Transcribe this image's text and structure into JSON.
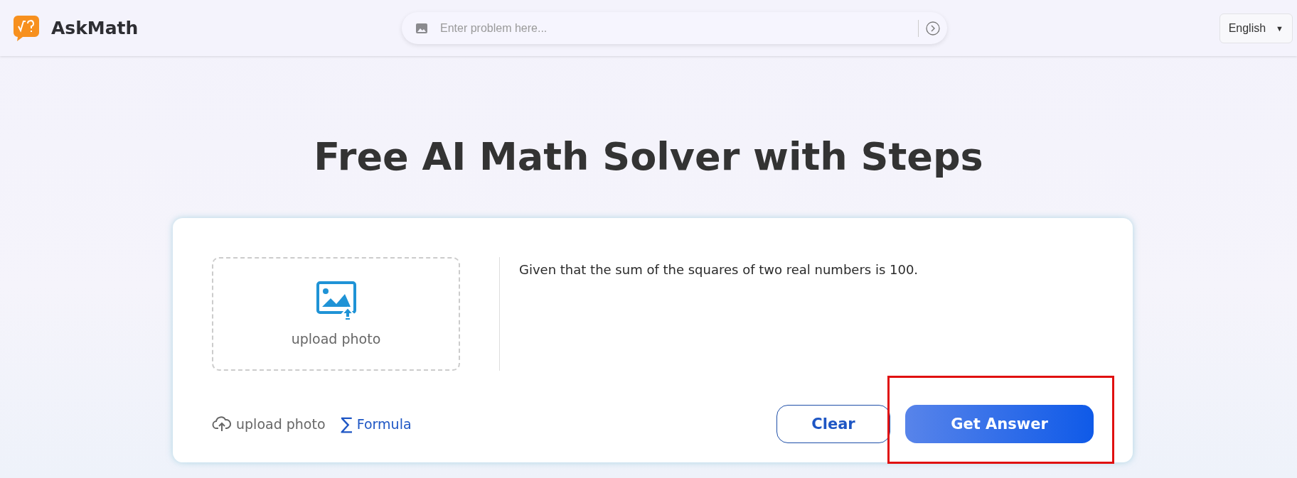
{
  "header": {
    "brand": "AskMath",
    "search": {
      "placeholder": "Enter problem here..."
    },
    "language": {
      "label": "English",
      "caret": "▼"
    }
  },
  "title": "Free AI Math Solver with Steps",
  "solver": {
    "upload_area": {
      "label": "upload photo"
    },
    "problem": {
      "value": "Given that the sum of the squares of two real numbers is 100."
    },
    "tools": [
      {
        "kind": "upload",
        "label": "upload photo"
      },
      {
        "kind": "formula",
        "label": "Formula",
        "symbol": "∑"
      }
    ],
    "buttons": [
      {
        "kind": "outline",
        "label": "Clear",
        "highlighted": false
      },
      {
        "kind": "primary",
        "label": "Get Answer",
        "highlighted": true
      }
    ]
  }
}
